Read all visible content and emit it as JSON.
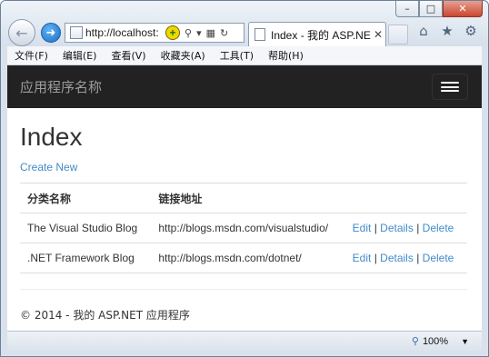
{
  "browser": {
    "address_url": "http://localhost:",
    "tab_title": "Index - 我的 ASP.NE...",
    "menu": [
      "文件(F)",
      "编辑(E)",
      "查看(V)",
      "收藏夹(A)",
      "工具(T)",
      "帮助(H)"
    ],
    "zoom": "100%"
  },
  "site": {
    "brand": "应用程序名称"
  },
  "page": {
    "heading": "Index",
    "create_link": "Create New",
    "table": {
      "headers": [
        "分类名称",
        "链接地址"
      ],
      "rows": [
        {
          "name": "The Visual Studio Blog",
          "url": "http://blogs.msdn.com/visualstudio/",
          "edit": "Edit",
          "details": "Details",
          "delete": "Delete"
        },
        {
          "name": ".NET Framework Blog",
          "url": "http://blogs.msdn.com/dotnet/",
          "edit": "Edit",
          "details": "Details",
          "delete": "Delete"
        }
      ]
    },
    "separator": "|",
    "footer": "© 2014 - 我的 ASP.NET 应用程序"
  },
  "colors": {
    "navbar": "#222222",
    "link": "#428bca",
    "close_button": "#c9472f"
  }
}
